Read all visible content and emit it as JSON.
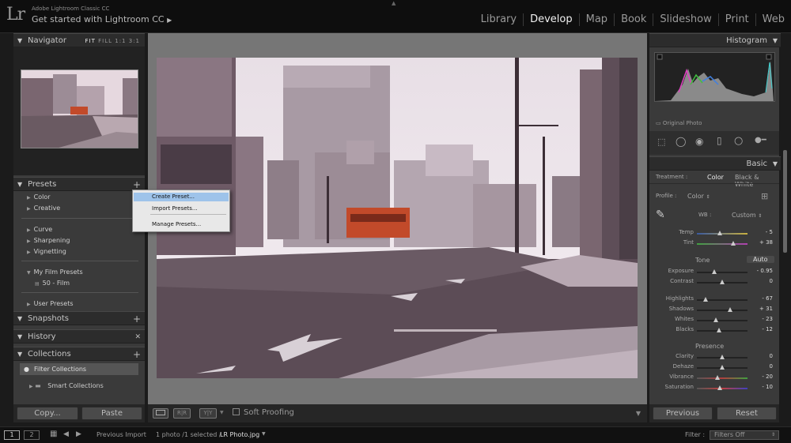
{
  "app": {
    "logo": "Lr",
    "title": "Adobe Lightroom Classic CC",
    "get_started": "Get started with Lightroom CC"
  },
  "modules": [
    {
      "label": "Library"
    },
    {
      "label": "Develop"
    },
    {
      "label": "Map"
    },
    {
      "label": "Book"
    },
    {
      "label": "Slideshow"
    },
    {
      "label": "Print"
    },
    {
      "label": "Web"
    }
  ],
  "navigator": {
    "title": "Navigator",
    "zoom": [
      "FIT",
      "FILL",
      "1:1",
      "3:1"
    ]
  },
  "presets": {
    "title": "Presets",
    "items": [
      "Color",
      "Creative",
      "Curve",
      "Sharpening",
      "Vignetting",
      "My Film Presets",
      "50 - Film",
      "User Presets"
    ]
  },
  "context_menu": {
    "items": [
      "Create Preset...",
      "Import Presets...",
      "Manage Presets..."
    ]
  },
  "snapshots": {
    "title": "Snapshots"
  },
  "history": {
    "title": "History"
  },
  "collections": {
    "title": "Collections",
    "filter": "Filter Collections",
    "smart": "Smart Collections"
  },
  "left_buttons": {
    "copy": "Copy...",
    "paste": "Paste"
  },
  "toolbar": {
    "soft_proofing": "Soft Proofing",
    "compare": "R|R",
    "yy": "Y|Y"
  },
  "histogram": {
    "title": "Histogram",
    "original": "Original Photo"
  },
  "basic": {
    "title": "Basic",
    "treatment_label": "Treatment :",
    "color": "Color",
    "bw": "Black & White",
    "profile_label": "Profile :",
    "profile_value": "Color",
    "wb_label": "WB :",
    "wb_value": "Custom",
    "tone": "Tone",
    "auto": "Auto",
    "presence": "Presence",
    "sliders": [
      {
        "label": "Temp",
        "value": "- 5",
        "pos": 0.45
      },
      {
        "label": "Tint",
        "value": "+ 38",
        "pos": 0.72
      },
      {
        "label": "Exposure",
        "value": "- 0.95",
        "pos": 0.35
      },
      {
        "label": "Contrast",
        "value": "0",
        "pos": 0.5
      },
      {
        "label": "Highlights",
        "value": "- 67",
        "pos": 0.17
      },
      {
        "label": "Shadows",
        "value": "+ 31",
        "pos": 0.65
      },
      {
        "label": "Whites",
        "value": "- 23",
        "pos": 0.38
      },
      {
        "label": "Blacks",
        "value": "- 12",
        "pos": 0.44
      },
      {
        "label": "Clarity",
        "value": "0",
        "pos": 0.5
      },
      {
        "label": "Dehaze",
        "value": "0",
        "pos": 0.5
      },
      {
        "label": "Vibrance",
        "value": "- 20",
        "pos": 0.4
      },
      {
        "label": "Saturation",
        "value": "- 10",
        "pos": 0.45
      }
    ]
  },
  "right_buttons": {
    "previous": "Previous",
    "reset": "Reset"
  },
  "bottom": {
    "screen1": "1",
    "screen2": "2",
    "prev_import": "Previous Import",
    "count": "1 photo /1 selected /",
    "file": "LR Photo.jpg",
    "filter_label": "Filter :",
    "filter_value": "Filters Off"
  },
  "colors": {
    "highlight": "#9ec3ea",
    "active_module": "#f0f0f0",
    "tram": "#c24a2a"
  }
}
